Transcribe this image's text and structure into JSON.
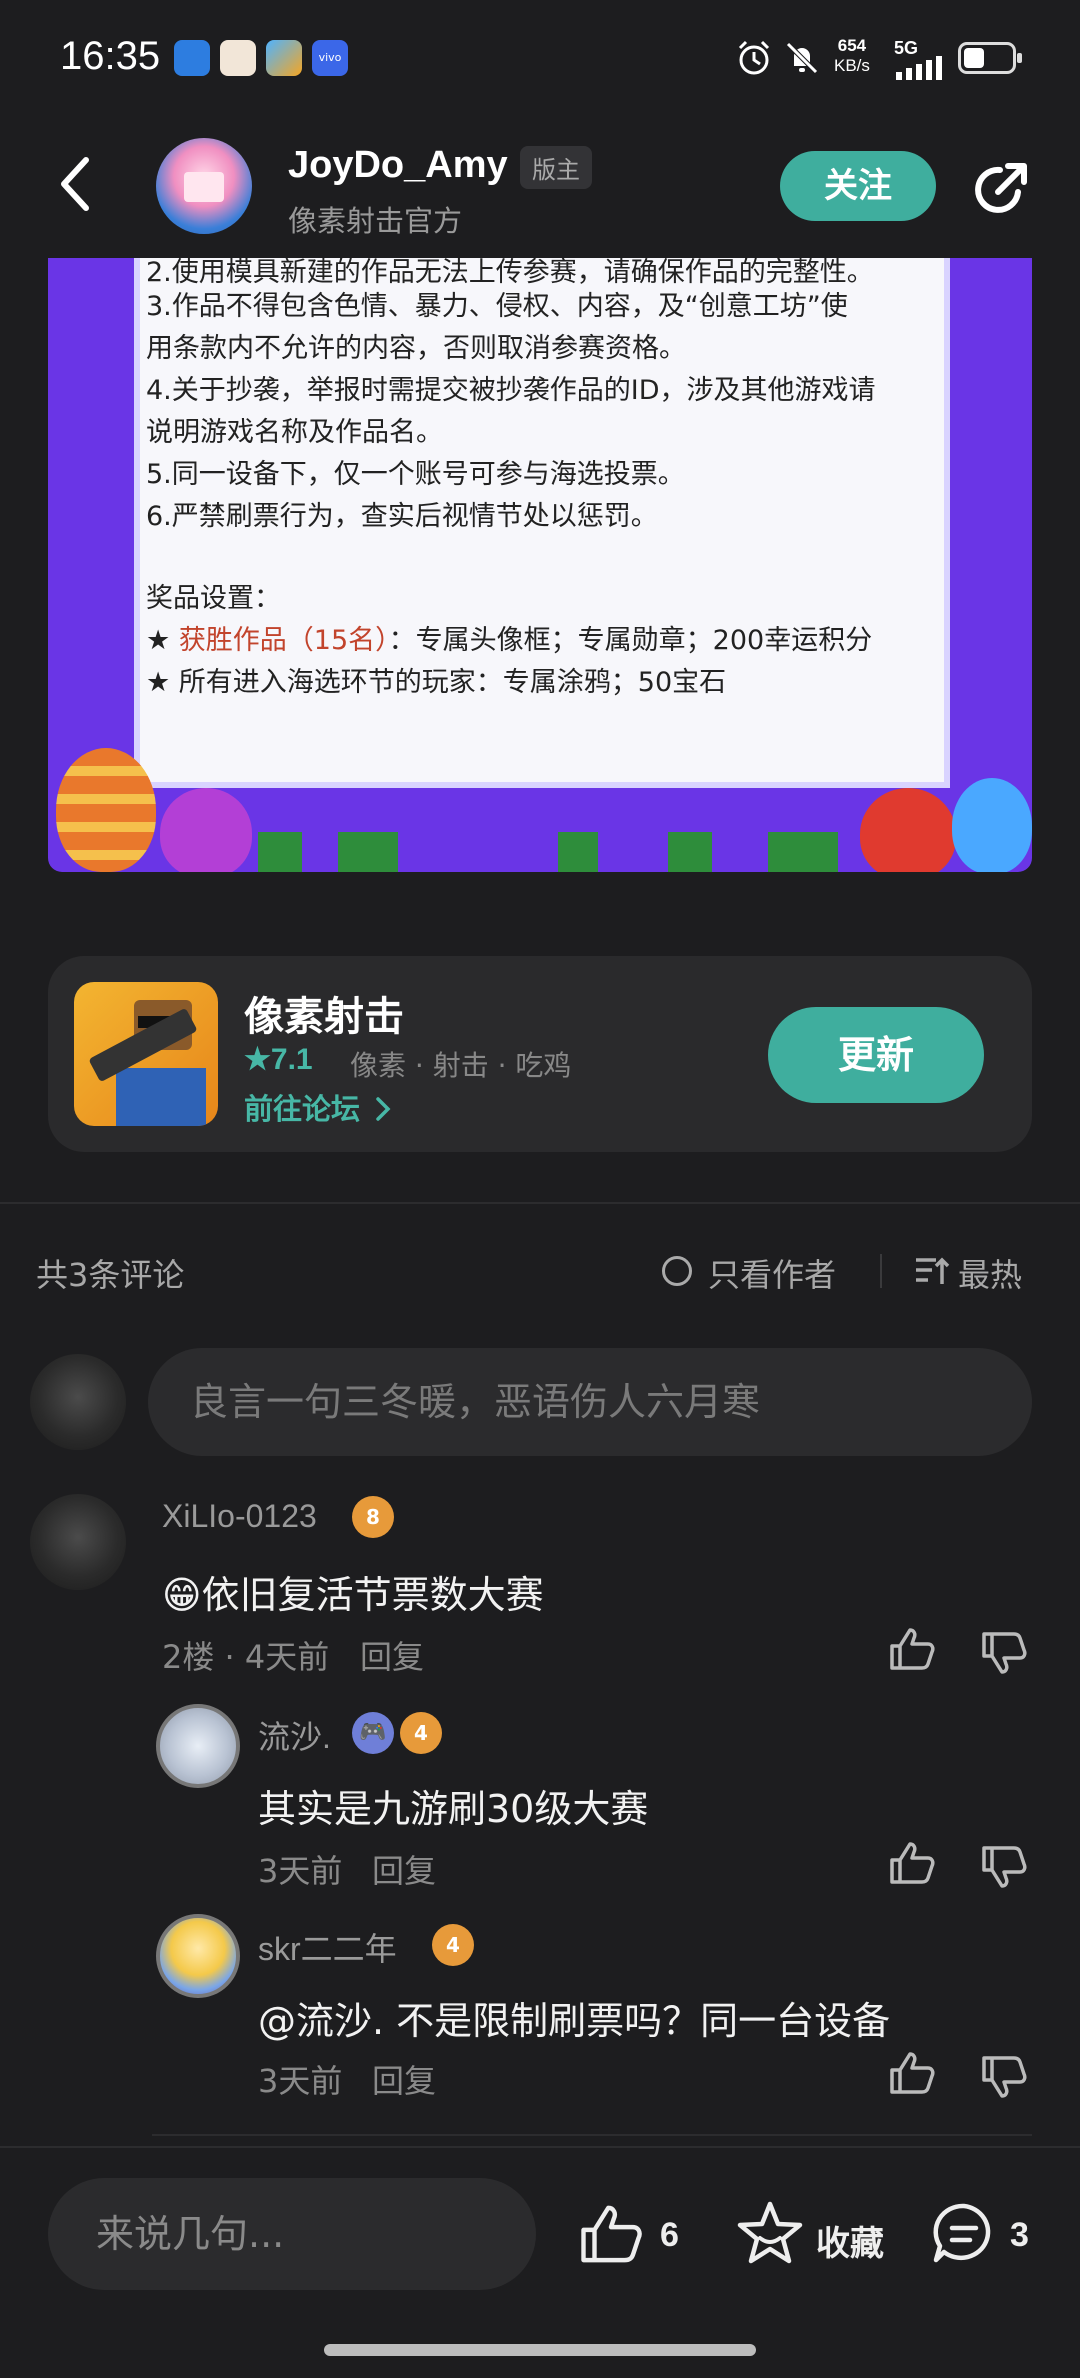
{
  "status_bar": {
    "time": "16:35",
    "net_speed_value": "654",
    "net_speed_unit": "KB/s",
    "network": "5G",
    "icons": [
      "app-icon-1",
      "app-icon-2",
      "app-icon-3",
      "vivo-icon",
      "alarm-icon",
      "mute-icon",
      "signal-icon",
      "battery-icon"
    ]
  },
  "header": {
    "username": "JoyDo_Amy",
    "role_badge": "版主",
    "subtitle": "像素射击官方",
    "follow_label": "关注"
  },
  "poster": {
    "lines": [
      "2.使用模具新建的作品无法上传参赛，请确保作品的完整性。",
      "3.作品不得包含色情、暴力、侵权、内容，及“创意工坊”使",
      "用条款内不允许的内容，否则取消参赛资格。",
      "4.关于抄袭，举报时需提交被抄袭作品的ID，涉及其他游戏请",
      "说明游戏名称及作品名。",
      "5.同一设备下，仅一个账号可参与海选投票。",
      "6.严禁刷票行为，查实后视情节处以惩罚。"
    ],
    "prize_title": "奖品设置：",
    "prize1_star": "★",
    "prize1_highlight": "获胜作品（15名）",
    "prize1_rest": "：专属头像框；专属勋章；200幸运积分",
    "prize2": "★ 所有进入海选环节的玩家：专属涂鸦；50宝石"
  },
  "app_card": {
    "name": "像素射击",
    "rating": "7.1",
    "tags": "像素 · 射击 · 吃鸡",
    "forum_link": "前往论坛",
    "update_label": "更新"
  },
  "comments_header": {
    "count": "共3条评论",
    "only_author": "只看作者",
    "sort": "最热"
  },
  "comment_input": {
    "placeholder": "良言一句三冬暖，恶语伤人六月寒"
  },
  "comments": [
    {
      "user": "XiLIo-0123",
      "level": "8",
      "emoji": "😁",
      "text": "依旧复活节票数大赛",
      "meta": "2楼 · 4天前",
      "reply_label": "回复"
    },
    {
      "user": "流沙.",
      "level": "4",
      "text": "其实是九游刷30级大赛",
      "meta": "3天前",
      "reply_label": "回复"
    },
    {
      "user": "skr二二年",
      "level": "4",
      "text": "@流沙. 不是限制刷票吗？同一台设备",
      "meta": "3天前",
      "reply_label": "回复"
    }
  ],
  "bottom_bar": {
    "input_placeholder": "来说几句...",
    "like_count": "6",
    "favorite_label": "收藏",
    "comment_count": "3"
  },
  "colors": {
    "accent": "#3fae9e",
    "background": "#1d1d1f",
    "poster_purple": "#6a35e6"
  }
}
